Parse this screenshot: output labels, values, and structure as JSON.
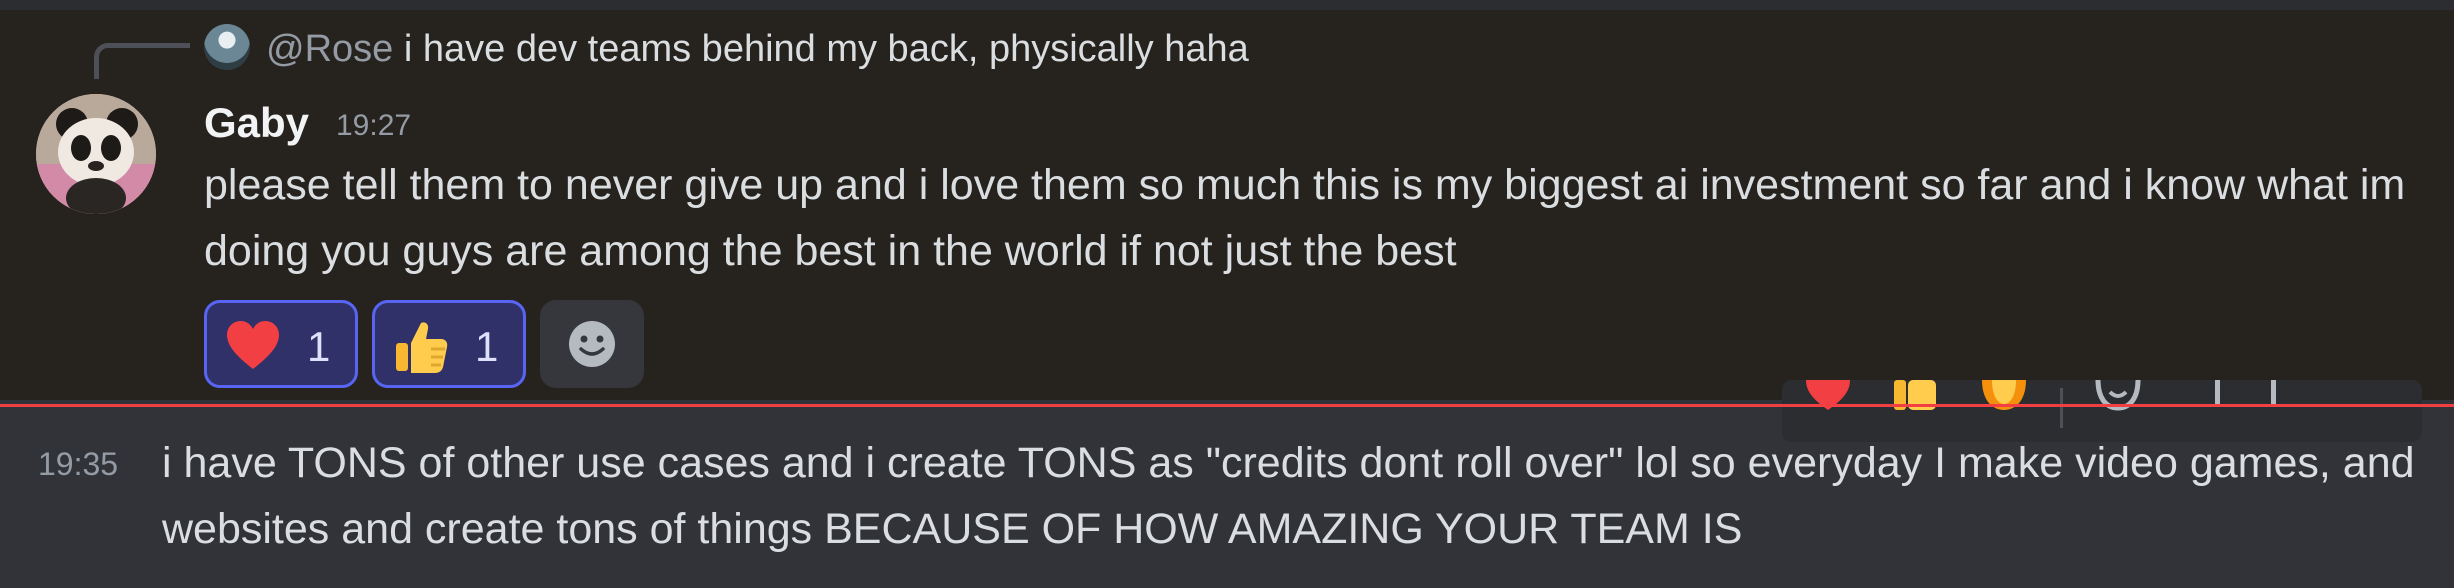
{
  "reply": {
    "mention": "@Rose",
    "text": "i have dev teams behind my back, physically haha"
  },
  "message1": {
    "username": "Gaby",
    "timestamp": "19:27",
    "body": "please tell them to never give up and i love them so much this is my biggest ai investment so far and i know what im doing you guys are among the best in the world if not just the best",
    "reactions": [
      {
        "emoji": "red-heart",
        "count": "1"
      },
      {
        "emoji": "thumbs-up",
        "count": "1"
      }
    ]
  },
  "message2": {
    "timestamp": "19:35",
    "body": "i have TONS of other use cases and i create TONS as \"credits dont roll over\" lol so everyday I make video games, and websites and create tons of things BECAUSE OF HOW AMAZING YOUR TEAM IS"
  },
  "colors": {
    "accent": "#5865f2",
    "new_divider": "#f23f43",
    "highlight_bg": "#26231f",
    "chat_bg": "#323339"
  }
}
